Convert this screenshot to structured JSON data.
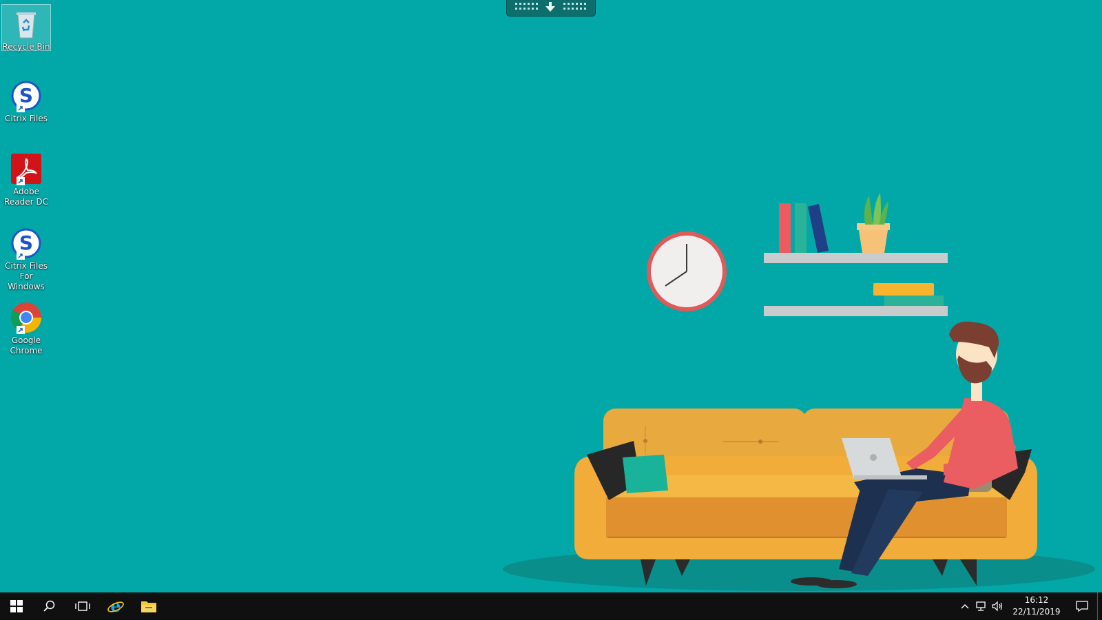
{
  "desktop": {
    "background_color": "#02a8a8",
    "icons": [
      {
        "label": "Recycle Bin",
        "icon": "recycle-bin-icon",
        "selected": true
      },
      {
        "label": "Citrix Files",
        "icon": "citrix-files-icon",
        "shortcut": true
      },
      {
        "label": "Adobe Reader DC",
        "icon": "adobe-reader-icon",
        "shortcut": true
      },
      {
        "label": "Citrix Files For Windows",
        "icon": "citrix-files-icon",
        "shortcut": true
      },
      {
        "label": "Google Chrome",
        "icon": "chrome-icon",
        "shortcut": true
      }
    ]
  },
  "remote_toolbar": {
    "icon": "download-arrow-icon"
  },
  "taskbar": {
    "background_color": "#101010",
    "buttons": [
      {
        "icon": "windows-start-icon"
      },
      {
        "icon": "search-icon"
      },
      {
        "icon": "task-view-icon"
      },
      {
        "icon": "internet-explorer-icon"
      },
      {
        "icon": "file-explorer-icon"
      }
    ],
    "tray": {
      "icons": [
        "chevron-up-icon",
        "network-icon",
        "volume-icon"
      ],
      "time": "16:12",
      "date": "22/11/2019",
      "notification_icon": "action-center-icon"
    }
  }
}
